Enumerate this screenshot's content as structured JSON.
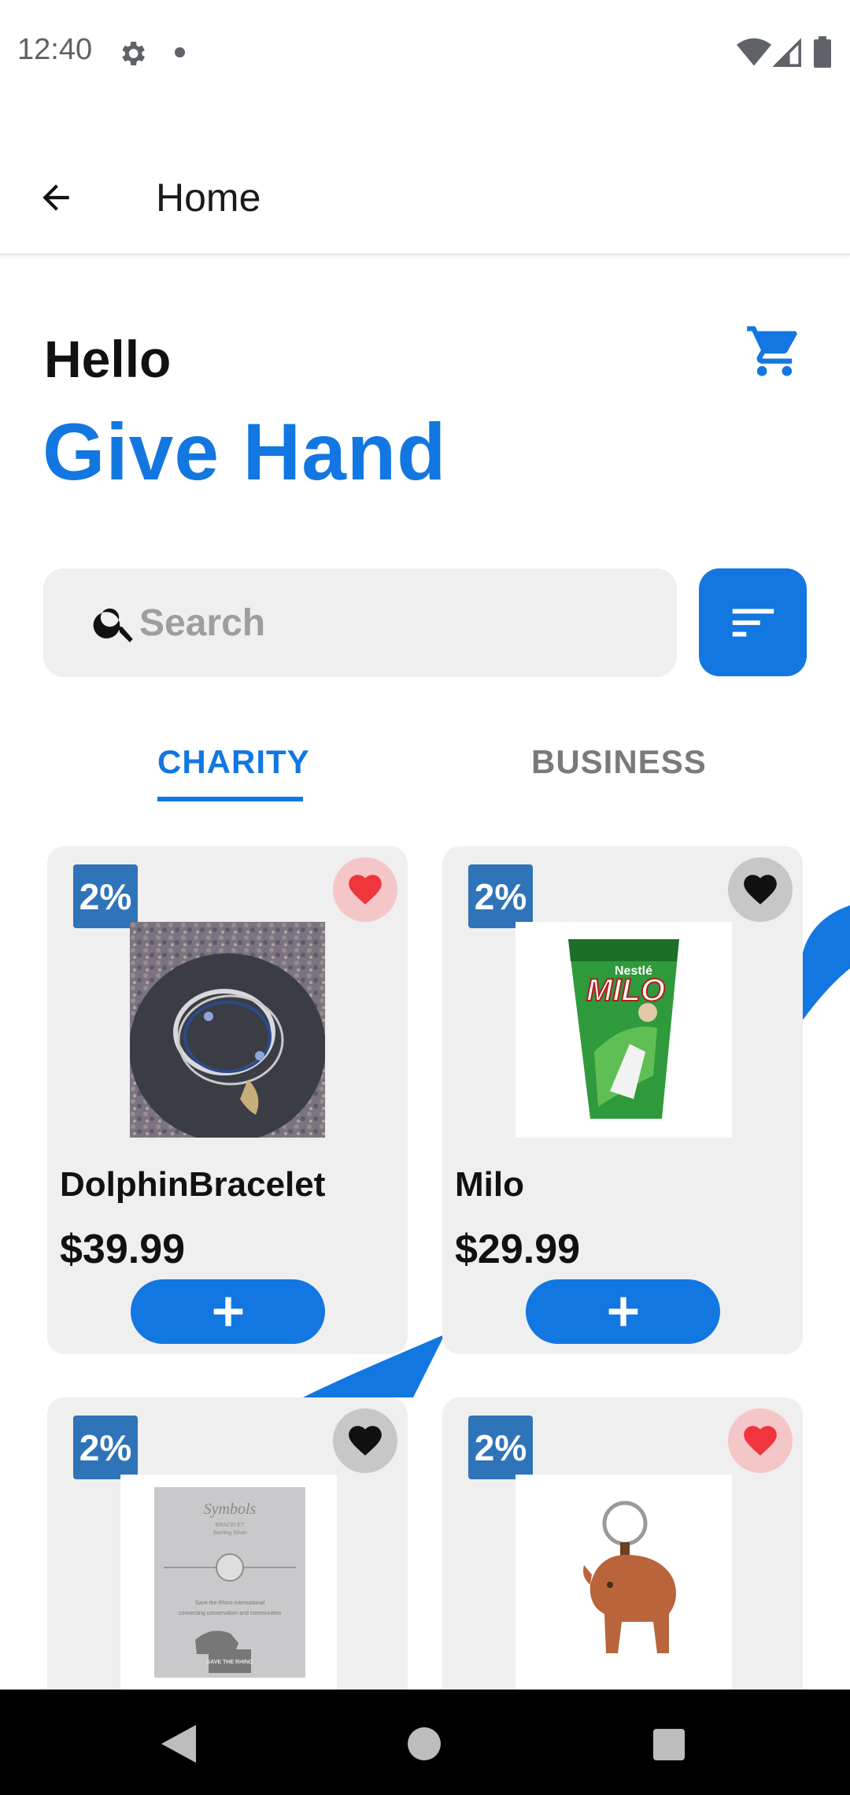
{
  "status_bar": {
    "time": "12:40"
  },
  "app_bar": {
    "title": "Home"
  },
  "greeting": {
    "hello": "Hello",
    "brand": "Give Hand"
  },
  "search": {
    "placeholder": "Search",
    "value": ""
  },
  "tabs": [
    {
      "label": "CHARITY",
      "selected": true
    },
    {
      "label": "BUSINESS",
      "selected": false
    }
  ],
  "products": [
    {
      "name": "DolphinBracelet",
      "price": "$39.99",
      "badge": "2%",
      "favorite": true
    },
    {
      "name": "Milo",
      "price": "$29.99",
      "badge": "2%",
      "favorite": false
    },
    {
      "name": "",
      "price": "",
      "badge": "2%",
      "favorite": false
    },
    {
      "name": "",
      "price": "",
      "badge": "2%",
      "favorite": true
    }
  ],
  "product_images": {
    "milo_brand": "MILO",
    "milo_maker": "Nestlé",
    "symbols_title": "Symbols",
    "symbols_line1": "BRACELET",
    "symbols_line2": "Sterling Silver",
    "symbols_caption1": "Save the Rhino International",
    "symbols_caption2": "connecting conservation and communities",
    "symbols_logo": "SAVE THE RHINO"
  },
  "colors": {
    "primary": "#1277e1",
    "badge": "#2f74b8",
    "favorite_active": "#f0353d",
    "card": "#efefef"
  },
  "icons": {
    "back": "arrow-left-icon",
    "cart": "cart-icon",
    "search": "search-icon",
    "filter": "sort-icon",
    "favorite": "heart-icon",
    "add": "plus-icon"
  }
}
